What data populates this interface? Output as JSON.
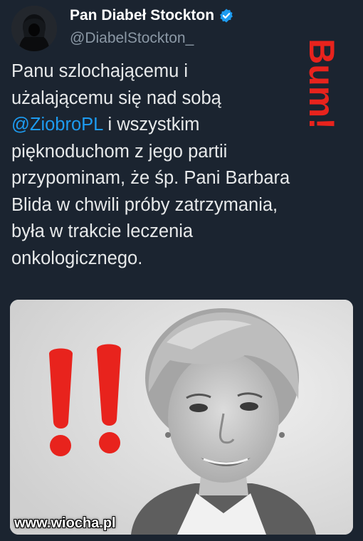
{
  "tweet": {
    "display_name": "Pan Diabeł Stockton",
    "handle": "@DiabelStockton_",
    "lines": [
      "Panu szlochającemu i",
      "użalającemu się nad sobą",
      [
        "@ZiobroPL",
        " i wszystkim"
      ],
      "pięknoduchom z jego partii",
      "przypominam, że śp. Pani Barbara",
      "Blida w chwili próby zatrzymania,",
      "była w trakcie leczenia",
      "onkologicznego."
    ],
    "mention": "@ZiobroPL",
    "line3_rest": " i wszystkim"
  },
  "overlay": {
    "stamp_text": "Bum!",
    "stamp_color": "#e8231d",
    "exclamation_marks": "!!"
  },
  "photo": {
    "description_icon": "portrait-photo"
  },
  "watermark": "www.wiocha.pl",
  "colors": {
    "background": "#1b2430",
    "text": "#e7e9ea",
    "handle": "#8b98a5",
    "mention": "#1d9bf0",
    "verified": "#1d9bf0"
  }
}
